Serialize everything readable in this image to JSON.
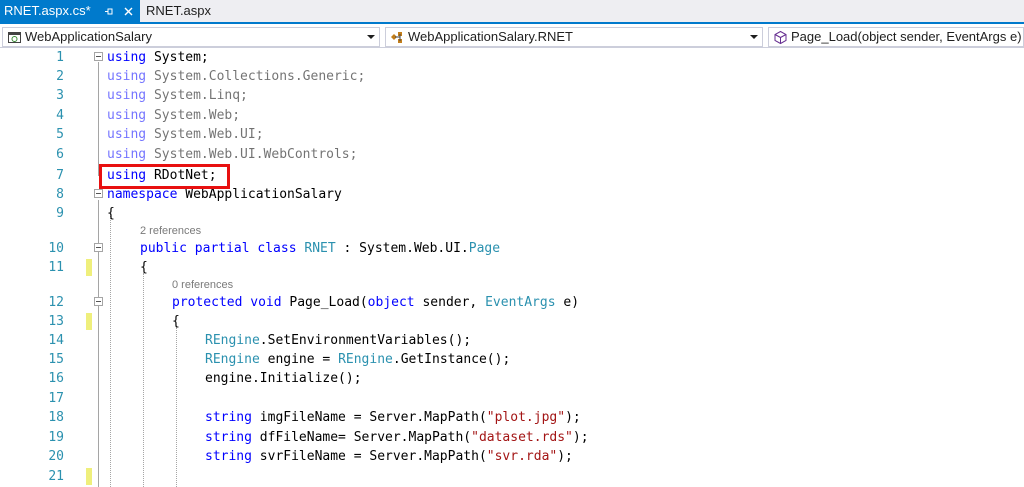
{
  "tabs": [
    {
      "label": "RNET.aspx.cs*",
      "active": true
    },
    {
      "label": "RNET.aspx",
      "active": false
    }
  ],
  "navbar": {
    "project": "WebApplicationSalary",
    "class": "WebApplicationSalary.RNET",
    "member": "Page_Load(object sender, EventArgs e)"
  },
  "code": {
    "line_numbers": [
      "1",
      "2",
      "3",
      "4",
      "5",
      "6",
      "7",
      "8",
      "9",
      "10",
      "11",
      "12",
      "13",
      "14",
      "15",
      "16",
      "17",
      "18",
      "19",
      "20",
      "21"
    ],
    "lens_class": "2 references",
    "lens_method": "0 references",
    "l1": {
      "kw": "using",
      "rest": " System;"
    },
    "l2": {
      "kw": "using",
      "rest": " System.Collections.Generic;"
    },
    "l3": {
      "kw": "using",
      "rest": " System.Linq;"
    },
    "l4": {
      "kw": "using",
      "rest": " System.Web;"
    },
    "l5": {
      "kw": "using",
      "rest": " System.Web.UI;"
    },
    "l6": {
      "kw": "using",
      "rest": " System.Web.UI.WebControls;"
    },
    "l7": {
      "kw": "using",
      "rest": " RDotNet;"
    },
    "l8": {
      "kw": "namespace",
      "rest": " WebApplicationSalary"
    },
    "l9": {
      "text": "{"
    },
    "l10": {
      "kw": "public partial class",
      "name": " RNET",
      "sep": " : System.Web.UI.",
      "base": "Page"
    },
    "l11": {
      "text": "{"
    },
    "l12": {
      "kw": "protected void",
      "m1": " Page_Load(",
      "kw2": "object",
      "m2": " sender, ",
      "ty": "EventArgs",
      "m3": " e)"
    },
    "l13": {
      "text": "{"
    },
    "l14": {
      "ty": "REngine",
      "rest": ".SetEnvironmentVariables();"
    },
    "l15": {
      "ty": "REngine",
      "mid": " engine = ",
      "ty2": "REngine",
      "rest": ".GetInstance();"
    },
    "l16": {
      "text": "engine.Initialize();"
    },
    "l18": {
      "kw": "string",
      "mid": " imgFileName = Server.MapPath(",
      "str": "\"plot.jpg\"",
      "end": ");"
    },
    "l19": {
      "kw": "string",
      "mid": " dfFileName= Server.MapPath(",
      "str": "\"dataset.rds\"",
      "end": ");"
    },
    "l20": {
      "kw": "string",
      "mid": " svrFileName = Server.MapPath(",
      "str": "\"svr.rda\"",
      "end": ");"
    }
  },
  "colors": {
    "accent": "#007acc",
    "keyword": "#0000ff",
    "type": "#2b91af",
    "string": "#a31515",
    "highlight": "#e81010",
    "change_marker": "#efef7c"
  }
}
